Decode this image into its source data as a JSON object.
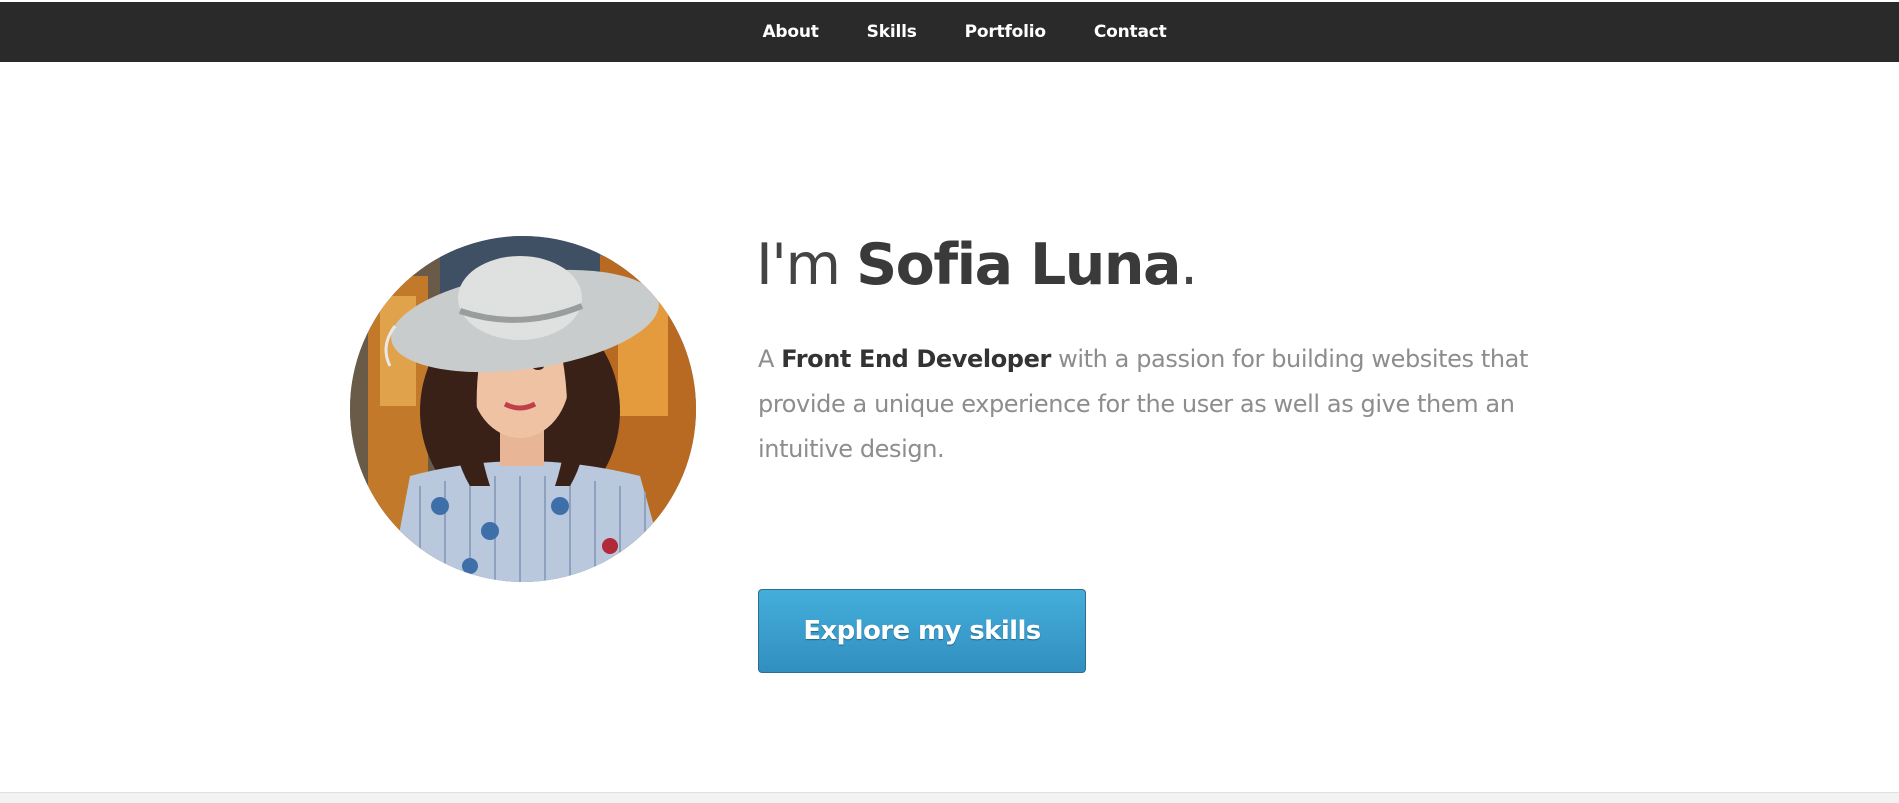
{
  "nav": {
    "items": [
      {
        "label": "About"
      },
      {
        "label": "Skills"
      },
      {
        "label": "Portfolio"
      },
      {
        "label": "Contact"
      }
    ]
  },
  "hero": {
    "greeting_prefix": "I'm ",
    "name": "Sofia Luna",
    "greeting_suffix": ".",
    "intro_prefix": "A ",
    "role": "Front End Developer",
    "intro_rest": " with a passion for building websites that provide a unique experience for the user as well as give them an intuitive design.",
    "cta_label": "Explore my skills"
  },
  "colors": {
    "navbar_bg": "#2a2a2a",
    "button_top": "#44aedb",
    "button_bottom": "#318fc0",
    "heading_text": "#3a3a3a",
    "body_text": "#8d8d8d"
  }
}
